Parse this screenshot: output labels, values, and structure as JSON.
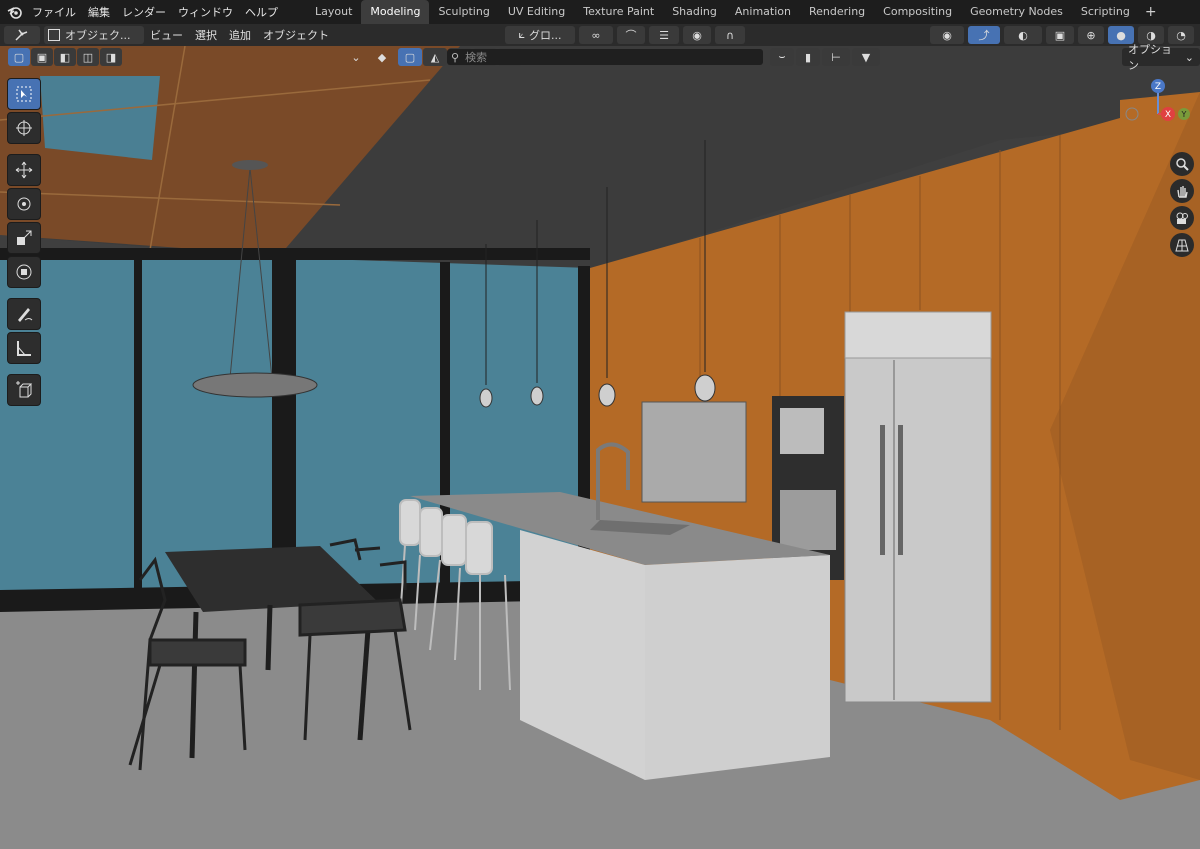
{
  "menu": {
    "items": [
      "ファイル",
      "編集",
      "レンダー",
      "ウィンドウ",
      "ヘルプ"
    ]
  },
  "workspaces": {
    "tabs": [
      "Layout",
      "Modeling",
      "Sculpting",
      "UV Editing",
      "Texture Paint",
      "Shading",
      "Animation",
      "Rendering",
      "Compositing",
      "Geometry Nodes",
      "Scripting"
    ],
    "active": "Modeling",
    "add_label": "+"
  },
  "header": {
    "mode_label": "オブジェク...",
    "view_label": "ビュー",
    "select_label": "選択",
    "add_label": "追加",
    "object_label": "オブジェクト",
    "transform_orientation": "グロ..."
  },
  "viewport": {
    "search_placeholder": "検索",
    "options_label": "オプション",
    "gizmo": {
      "z_label": "Z",
      "x_label": "X",
      "y_label": "Y"
    }
  },
  "colors": {
    "accent": "#4772b3",
    "wall_orange": "#b76b25",
    "window_blue": "#4b8296",
    "ceiling": "#3b3b3b",
    "floor": "#8c8c8c"
  },
  "icons": [
    "blender-logo-icon",
    "select-box-icon",
    "cursor-icon",
    "move-icon",
    "rotate-icon",
    "scale-icon",
    "transform-icon",
    "annotate-icon",
    "measure-icon",
    "add-cube-icon",
    "zoom-icon",
    "hand-icon",
    "camera-icon",
    "grid-icon"
  ]
}
